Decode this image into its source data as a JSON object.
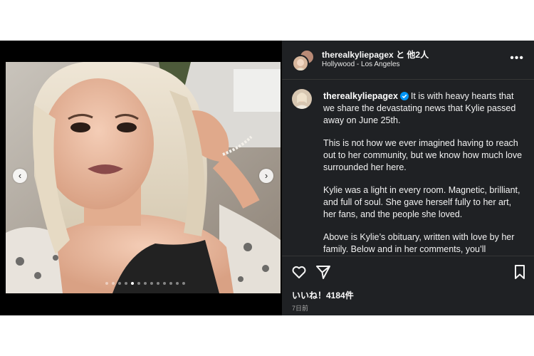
{
  "post": {
    "header": {
      "username": "therealkyliepagex",
      "collab_text": "と 他2人",
      "location": "Hollywood - Los Angeles",
      "more_icon": "more-horizontal-icon"
    },
    "caption": {
      "username": "therealkyliepagex",
      "verified": true,
      "paragraphs": [
        "It is with heavy hearts that we share the devastating news that Kylie passed away on June 25th.",
        "This is not how we ever imagined having to reach out to her community, but we know how much love surrounded her here.",
        "Kylie was a light in every room.  Magnetic, brilliant, and full of soul. She gave herself fully to her art, her fans, and the people she loved.",
        "Above is Kylie’s obituary, written with love by her family. Below and in her comments, you’ll"
      ]
    },
    "carousel": {
      "prev_icon": "chevron-left-icon",
      "next_icon": "chevron-right-icon",
      "prev_glyph": "‹",
      "next_glyph": "›",
      "slide_count": 13,
      "active_index": 4
    },
    "actions": {
      "like_icon": "heart-icon",
      "share_icon": "send-icon",
      "save_icon": "bookmark-icon"
    },
    "likes_text": "いいね！4184件",
    "time_ago": "7日前"
  },
  "colors": {
    "panel_bg": "#1f2124",
    "verified_blue": "#0095f6",
    "text": "#f5f5f5"
  }
}
